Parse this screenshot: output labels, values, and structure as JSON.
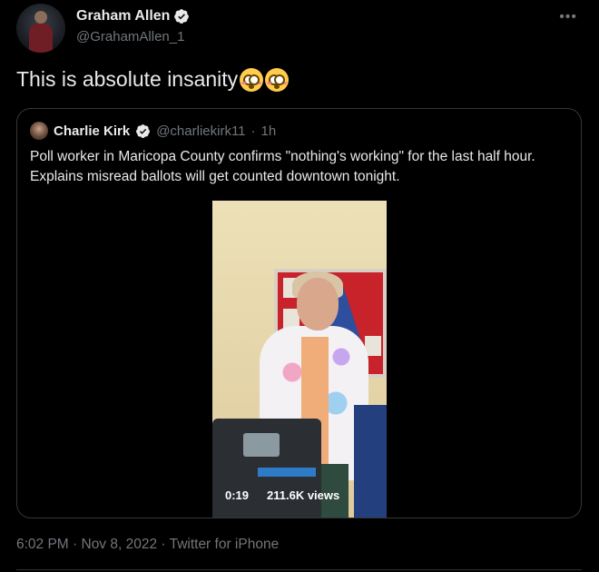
{
  "author": {
    "name": "Graham Allen",
    "handle": "@GrahamAllen_1",
    "verified": true
  },
  "menu_icon": "more-dots-icon",
  "tweet": {
    "text": "This is absolute insanity",
    "emojis": [
      "flushed-face",
      "flushed-face"
    ]
  },
  "quote": {
    "name": "Charlie Kirk",
    "handle": "@charliekirk11",
    "separator": "·",
    "age": "1h",
    "verified": true,
    "text": "Poll worker in Maricopa County confirms \"nothing's working\" for the last half hour. Explains misread ballots will get counted downtown tonight.",
    "video": {
      "time": "0:19",
      "views": "211.6K views"
    }
  },
  "meta": {
    "text": "6:02 PM · Nov 8, 2022 · Twitter for iPhone"
  },
  "colors": {
    "background": "#000000",
    "text": "#e7e9ea",
    "secondary": "#71767b",
    "verified": "#1d9bf0",
    "border": "#333639"
  }
}
